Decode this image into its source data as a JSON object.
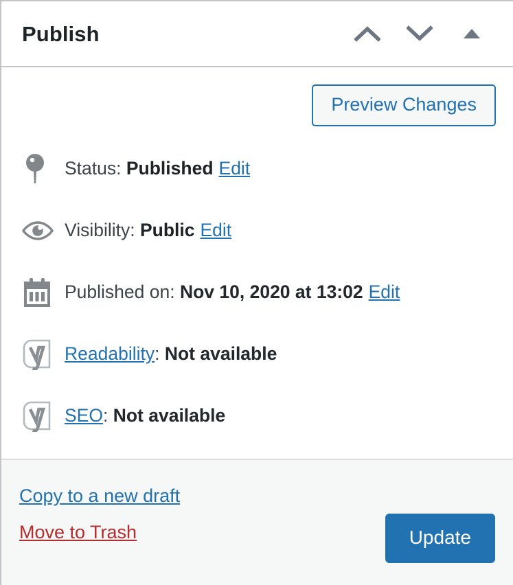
{
  "panel": {
    "title": "Publish",
    "header_controls": [
      {
        "name": "move-up",
        "icon": "chevron-up-icon"
      },
      {
        "name": "move-down",
        "icon": "chevron-down-icon"
      },
      {
        "name": "toggle-panel",
        "icon": "triangle-up-icon"
      }
    ]
  },
  "preview": {
    "button_label": "Preview Changes"
  },
  "meta": {
    "status": {
      "icon": "pin-icon",
      "label": "Status:",
      "value": "Published",
      "edit_label": "Edit"
    },
    "visibility": {
      "icon": "eye-icon",
      "label": "Visibility:",
      "value": "Public",
      "edit_label": "Edit"
    },
    "published_on": {
      "icon": "calendar-icon",
      "label": "Published on:",
      "value": "Nov 10, 2020 at 13:02",
      "edit_label": "Edit"
    },
    "readability": {
      "icon": "yoast-icon",
      "link_label": "Readability",
      "separator": ":",
      "value": "Not available"
    },
    "seo": {
      "icon": "yoast-icon",
      "link_label": "SEO",
      "separator": ":",
      "value": "Not available"
    }
  },
  "footer": {
    "copy_draft_label": "Copy to a new draft",
    "trash_label": "Move to Trash",
    "update_label": "Update"
  },
  "colors": {
    "accent_blue": "#2271b1",
    "danger_red": "#b32d2e",
    "icon_gray": "#82878c",
    "text_dark": "#1d2327",
    "text_body": "#3c434a",
    "footer_bg": "#f6f7f7",
    "border_gray": "#c3c4c7"
  }
}
